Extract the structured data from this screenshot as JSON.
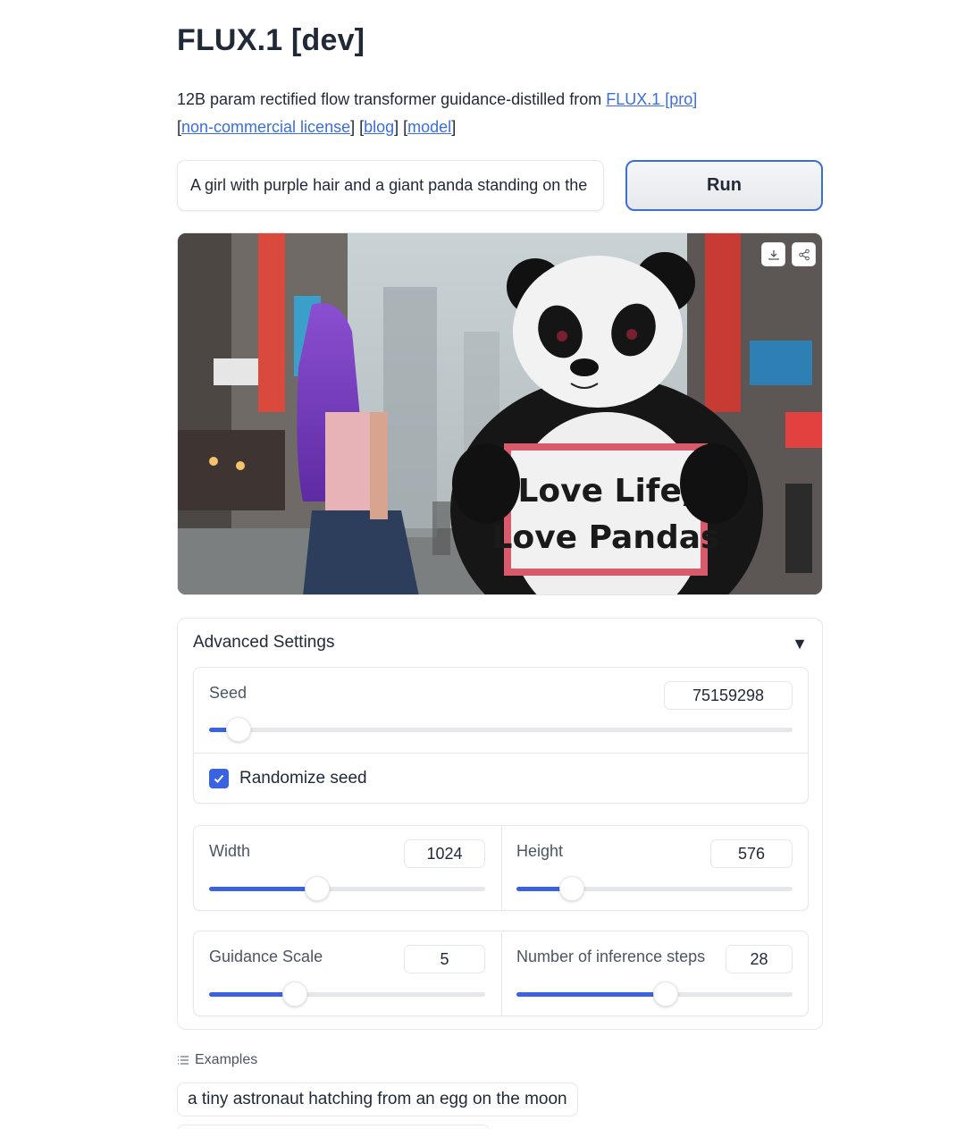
{
  "header": {
    "title": "FLUX.1 [dev]",
    "description_prefix": "12B param rectified flow transformer guidance-distilled from ",
    "link_flux_pro": "FLUX.1 [pro]",
    "link_license": "non-commercial license",
    "link_blog": "blog",
    "link_model": "model"
  },
  "prompt": {
    "value": "A girl with purple hair and a giant panda standing on the"
  },
  "run_label": "Run",
  "image": {
    "sign_line1": "Love Life,",
    "sign_line2": "Love Pandas"
  },
  "advanced": {
    "title": "Advanced Settings",
    "seed": {
      "label": "Seed",
      "value": "75159298",
      "fraction": 0.05
    },
    "randomize": {
      "label": "Randomize seed",
      "checked": true
    },
    "width": {
      "label": "Width",
      "value": "1024",
      "fraction": 0.39
    },
    "height": {
      "label": "Height",
      "value": "576",
      "fraction": 0.2
    },
    "guidance": {
      "label": "Guidance Scale",
      "value": "5",
      "fraction": 0.31
    },
    "steps": {
      "label": "Number of inference steps",
      "value": "28",
      "fraction": 0.54
    }
  },
  "examples": {
    "label": "Examples",
    "items": [
      "a tiny astronaut hatching from an egg on the moon"
    ]
  },
  "colors": {
    "accent": "#3b62e0",
    "link": "#3b6fd8"
  },
  "icons": [
    "download-icon",
    "share-icon",
    "caret-down-icon",
    "check-icon",
    "list-icon"
  ]
}
